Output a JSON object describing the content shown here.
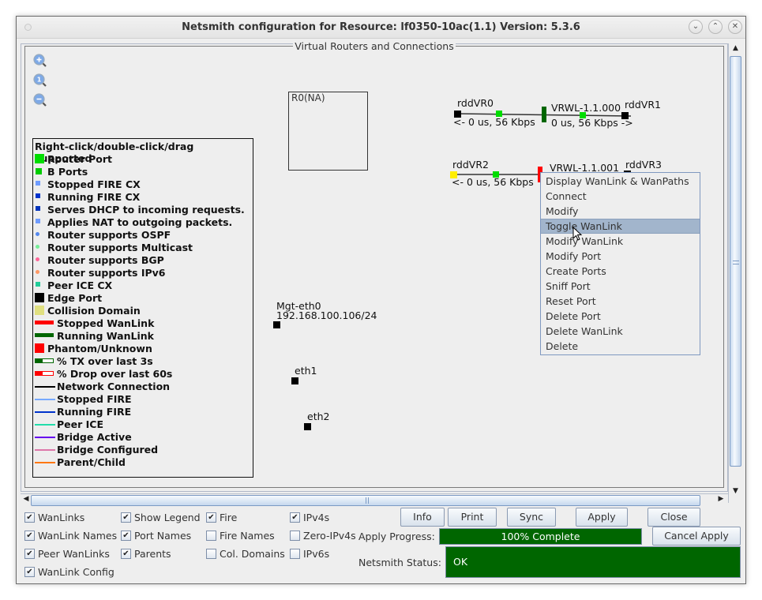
{
  "window": {
    "title": "Netsmith configuration for Resource:  lf0350-10ac(1.1)  Version: 5.3.6",
    "controls": [
      "minimize",
      "maximize",
      "close"
    ]
  },
  "canvas": {
    "group_title": "Virtual Routers and Connections",
    "zoom_tools": [
      "zoom-in",
      "zoom-reset",
      "zoom-out"
    ],
    "router": {
      "label": "R0(NA)"
    },
    "wanlinks": [
      {
        "name": "VRWL-1.1.000",
        "left_endpoint": "rddVR0",
        "right_endpoint": "rddVR1",
        "left_stats": "<- 0 us, 56 Kbps",
        "right_stats": "0 us, 56 Kbps ->",
        "state": "running",
        "state_color": "#006600"
      },
      {
        "name": "VRWL-1.1.001",
        "left_endpoint": "rddVR2",
        "right_endpoint": "rddVR3",
        "left_stats": "<- 0 us, 56 Kbps",
        "state": "stopped",
        "state_color": "#ff0000"
      }
    ],
    "ports": [
      {
        "name": "Mgt-eth0",
        "ip": "192.168.100.106/24"
      },
      {
        "name": "eth1"
      },
      {
        "name": "eth2"
      }
    ]
  },
  "legend": {
    "header": "Right-click/double-click/drag supported",
    "items": [
      {
        "label": "Router Port",
        "color": "#00dd00",
        "shape": "square-large"
      },
      {
        "label": "B Ports",
        "color": "#00cc00",
        "shape": "square"
      },
      {
        "label": "Stopped FIRE CX",
        "color": "#6f9cff",
        "shape": "square-small"
      },
      {
        "label": "Running FIRE CX",
        "color": "#0033cc",
        "shape": "square-small"
      },
      {
        "label": "Serves DHCP to incoming requests.",
        "color": "#0033bb",
        "shape": "square-small"
      },
      {
        "label": "Applies NAT to outgoing packets.",
        "color": "#6f9cff",
        "shape": "square-small"
      },
      {
        "label": "Router supports OSPF",
        "color": "#5588ee",
        "shape": "dot"
      },
      {
        "label": "Router supports Multicast",
        "color": "#77ee99",
        "shape": "dot"
      },
      {
        "label": "Router supports BGP",
        "color": "#ff6699",
        "shape": "dot"
      },
      {
        "label": "Router supports IPv6",
        "color": "#ff9966",
        "shape": "dot"
      },
      {
        "label": "Peer ICE CX",
        "color": "#22cc99",
        "shape": "square-small"
      },
      {
        "label": "Edge Port",
        "color": "#000000",
        "shape": "square-large"
      },
      {
        "label": "Collision Domain",
        "color": "#e0e080",
        "shape": "square-large"
      },
      {
        "label": "Stopped WanLink",
        "color": "#ff0000",
        "shape": "bar"
      },
      {
        "label": "Running WanLink",
        "color": "#006600",
        "shape": "bar"
      },
      {
        "label": "Phantom/Unknown",
        "color": "#ff0000",
        "shape": "square-large"
      },
      {
        "label": "% TX over last 3s",
        "color": "#006600",
        "shape": "meter"
      },
      {
        "label": "% Drop over last 60s",
        "color": "#ff0000",
        "shape": "meter"
      },
      {
        "label": "Network Connection",
        "color": "#000000",
        "shape": "line"
      },
      {
        "label": "Stopped FIRE",
        "color": "#77aaff",
        "shape": "line"
      },
      {
        "label": "Running FIRE",
        "color": "#0033cc",
        "shape": "line"
      },
      {
        "label": "Peer ICE",
        "color": "#22ddaa",
        "shape": "line"
      },
      {
        "label": "Bridge Active",
        "color": "#6600ee",
        "shape": "line"
      },
      {
        "label": "Bridge Configured",
        "color": "#dd77aa",
        "shape": "line"
      },
      {
        "label": "Parent/Child",
        "color": "#ff7711",
        "shape": "line"
      }
    ]
  },
  "context_menu": {
    "items": [
      "Display WanLink & WanPaths",
      "Connect",
      "Modify",
      "Toggle WanLink",
      "Modify WanLink",
      "Modify Port",
      "Create Ports",
      "Sniff Port",
      "Reset Port",
      "Delete Port",
      "Delete WanLink",
      "Delete"
    ],
    "highlighted": "Toggle WanLink"
  },
  "options": {
    "checkboxes": [
      {
        "label": "WanLinks",
        "checked": true
      },
      {
        "label": "WanLink Names",
        "checked": true
      },
      {
        "label": "Peer WanLinks",
        "checked": true
      },
      {
        "label": "WanLink Config",
        "checked": true
      },
      {
        "label": "Show Legend",
        "checked": true
      },
      {
        "label": "Port Names",
        "checked": true
      },
      {
        "label": "Parents",
        "checked": true
      },
      {
        "label": "Fire",
        "checked": true
      },
      {
        "label": "Fire Names",
        "checked": false
      },
      {
        "label": "Col. Domains",
        "checked": false
      },
      {
        "label": "IPv4s",
        "checked": true
      },
      {
        "label": "Zero-IPv4s",
        "checked": false
      },
      {
        "label": "IPv6s",
        "checked": false
      }
    ]
  },
  "buttons": {
    "info": "Info",
    "print": "Print",
    "sync": "Sync",
    "apply": "Apply",
    "close": "Close",
    "cancel_apply": "Cancel Apply"
  },
  "apply_progress": {
    "label": "Apply Progress:",
    "text": "100% Complete",
    "percent": 100
  },
  "netsmith_status": {
    "label": "Netsmith Status:",
    "value": "OK"
  }
}
